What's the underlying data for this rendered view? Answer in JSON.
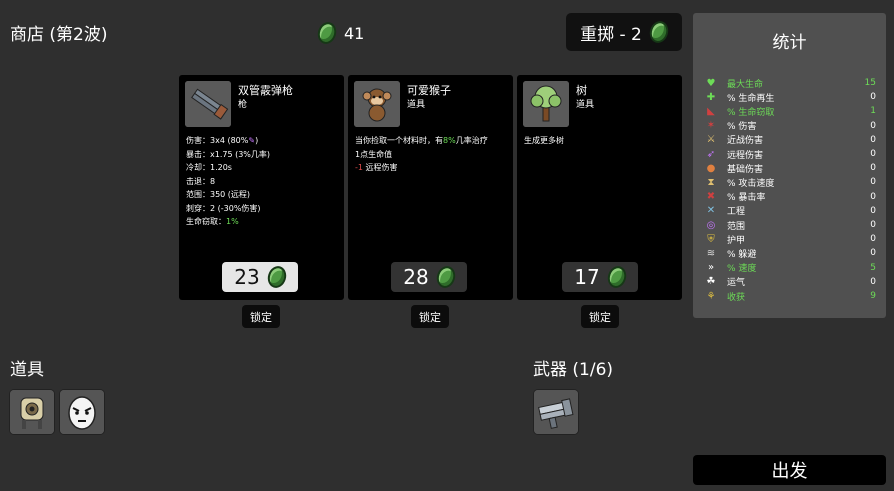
{
  "header": {
    "title": "商店 (第2波)",
    "money": "41",
    "reroll_label": "重掷 - 2"
  },
  "shop": {
    "cards": [
      {
        "name": "双管霰弹枪",
        "kind": "枪",
        "price": "23",
        "price_active": true,
        "lock_label": "锁定",
        "icon": "double-barrel-shotgun-icon",
        "desc_lines": [
          {
            "parts": [
              {
                "t": "伤害：3x4 (80%",
                "c": ""
              },
              {
                "t": "✎",
                "c": "purple"
              },
              {
                "t": ")",
                "c": ""
              }
            ]
          },
          {
            "parts": [
              {
                "t": "暴击：x1.75 (3%几率)",
                "c": ""
              }
            ]
          },
          {
            "parts": [
              {
                "t": "冷却：1.20s",
                "c": ""
              }
            ]
          },
          {
            "parts": [
              {
                "t": "击退：8",
                "c": ""
              }
            ]
          },
          {
            "parts": [
              {
                "t": "范围：350 (远程)",
                "c": ""
              }
            ]
          },
          {
            "parts": [
              {
                "t": "刺穿：2 (-30%伤害)",
                "c": ""
              }
            ]
          },
          {
            "parts": [
              {
                "t": "生命窃取：",
                "c": ""
              },
              {
                "t": "1%",
                "c": "pos"
              }
            ]
          }
        ]
      },
      {
        "name": "可爱猴子",
        "kind": "道具",
        "price": "28",
        "price_active": false,
        "lock_label": "锁定",
        "icon": "cute-monkey-icon",
        "desc_lines": [
          {
            "parts": [
              {
                "t": "当你捡取一个材料时，有",
                "c": ""
              },
              {
                "t": "8%",
                "c": "pos"
              },
              {
                "t": "几率治疗",
                "c": ""
              }
            ]
          },
          {
            "parts": [
              {
                "t": "1点生命值",
                "c": ""
              }
            ]
          },
          {
            "parts": [
              {
                "t": "-1",
                "c": "neg"
              },
              {
                "t": " 远程伤害",
                "c": ""
              }
            ]
          }
        ]
      },
      {
        "name": "树",
        "kind": "道具",
        "price": "17",
        "price_active": false,
        "lock_label": "锁定",
        "icon": "tree-icon",
        "desc_lines": [
          {
            "parts": [
              {
                "t": "生成更多树",
                "c": ""
              }
            ]
          }
        ]
      }
    ]
  },
  "items": {
    "title": "道具",
    "slots": [
      {
        "icon": "robot-item-icon"
      },
      {
        "icon": "angry-egg-item-icon"
      }
    ]
  },
  "weapons": {
    "title": "武器 (1/6)",
    "slots": [
      {
        "icon": "shotgun-weapon-icon"
      }
    ]
  },
  "stats": {
    "title": "统计",
    "rows": [
      {
        "label": "最大生命",
        "value": "15",
        "color": "#6ddc57",
        "icon": "heart-icon",
        "glyph": "♥",
        "icolor": "#6ddc57"
      },
      {
        "label": "% 生命再生",
        "value": "0",
        "color": "#ffffff",
        "icon": "regen-icon",
        "glyph": "✚",
        "icolor": "#6ddc57"
      },
      {
        "label": "% 生命窃取",
        "value": "1",
        "color": "#6ddc57",
        "icon": "lifesteal-icon",
        "glyph": "◣",
        "icolor": "#d04040"
      },
      {
        "label": "% 伤害",
        "value": "0",
        "color": "#ffffff",
        "icon": "damage-icon",
        "glyph": "✶",
        "icolor": "#d04040"
      },
      {
        "label": "近战伤害",
        "value": "0",
        "color": "#ffffff",
        "icon": "melee-icon",
        "glyph": "⚔",
        "icolor": "#e0c070"
      },
      {
        "label": "远程伤害",
        "value": "0",
        "color": "#ffffff",
        "icon": "ranged-icon",
        "glyph": "➶",
        "icolor": "#c777ff"
      },
      {
        "label": "基础伤害",
        "value": "0",
        "color": "#ffffff",
        "icon": "elemental-icon",
        "glyph": "●",
        "icolor": "#e08040"
      },
      {
        "label": "% 攻击速度",
        "value": "0",
        "color": "#ffffff",
        "icon": "attack-speed-icon",
        "glyph": "⧗",
        "icolor": "#e0c070"
      },
      {
        "label": "% 暴击率",
        "value": "0",
        "color": "#ffffff",
        "icon": "crit-icon",
        "glyph": "✖",
        "icolor": "#d04040"
      },
      {
        "label": "工程",
        "value": "0",
        "color": "#ffffff",
        "icon": "engineering-icon",
        "glyph": "✕",
        "icolor": "#80c0e0"
      },
      {
        "label": "范围",
        "value": "0",
        "color": "#ffffff",
        "icon": "range-icon",
        "glyph": "◎",
        "icolor": "#c777ff"
      },
      {
        "label": "护甲",
        "value": "0",
        "color": "#ffffff",
        "icon": "armor-icon",
        "glyph": "⛨",
        "icolor": "#e0c040"
      },
      {
        "label": "% 躲避",
        "value": "0",
        "color": "#ffffff",
        "icon": "dodge-icon",
        "glyph": "≋",
        "icolor": "#dddddd"
      },
      {
        "label": "% 速度",
        "value": "5",
        "color": "#6ddc57",
        "icon": "speed-icon",
        "glyph": "»",
        "icolor": "#ffffff"
      },
      {
        "label": "运气",
        "value": "0",
        "color": "#ffffff",
        "icon": "luck-icon",
        "glyph": "☘",
        "icolor": "#ffffff"
      },
      {
        "label": "收获",
        "value": "9",
        "color": "#6ddc57",
        "icon": "harvest-icon",
        "glyph": "⚘",
        "icolor": "#e0c040"
      }
    ]
  },
  "go_button": "出发"
}
